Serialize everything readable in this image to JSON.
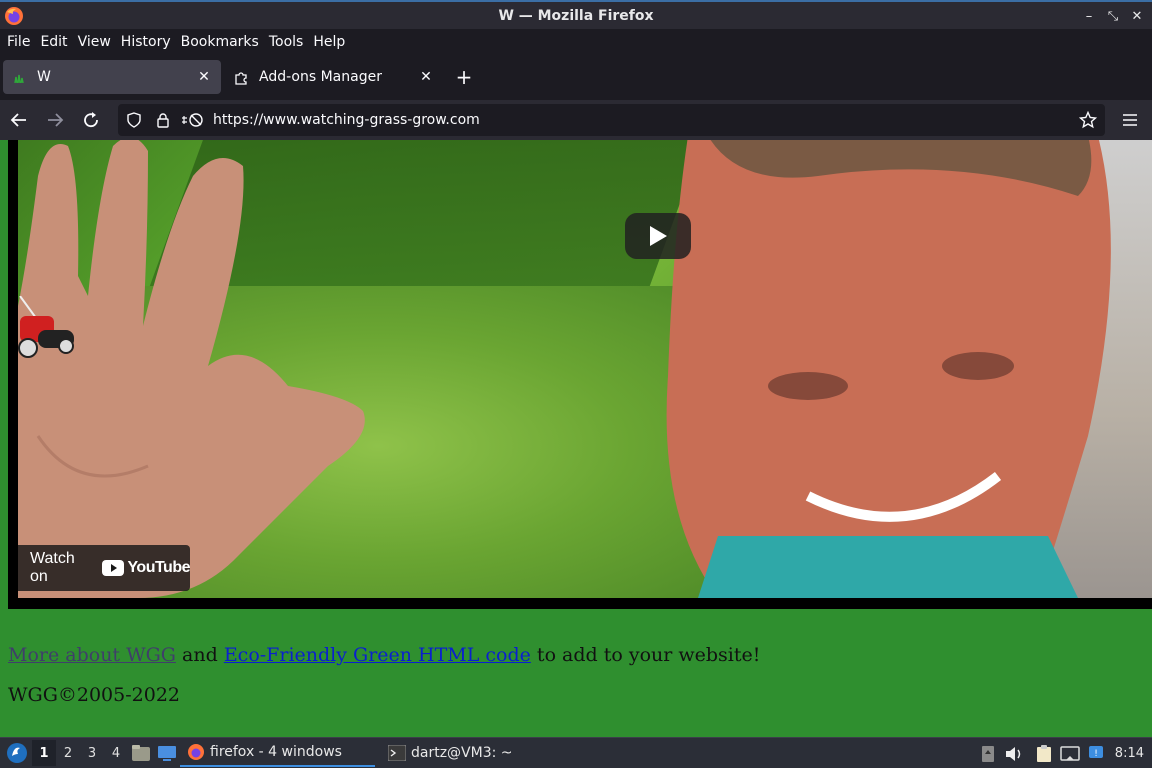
{
  "window": {
    "title": "W — Mozilla Firefox"
  },
  "menubar": {
    "items": [
      "File",
      "Edit",
      "View",
      "History",
      "Bookmarks",
      "Tools",
      "Help"
    ]
  },
  "tabs": [
    {
      "label": "W",
      "active": true,
      "icon": "grass-favicon"
    },
    {
      "label": "Add-ons Manager",
      "active": false,
      "icon": "puzzle-icon"
    }
  ],
  "navbar": {
    "url": "https://www.watching-grass-grow.com"
  },
  "video": {
    "watch_on_label": "Watch on",
    "youtube_wordmark": "YouTube"
  },
  "content": {
    "link_more": "More about WGG",
    "text_and": " and ",
    "link_eco": "Eco-Friendly Green HTML code",
    "text_tail": " to add to your website!",
    "copyright": "WGG©2005-2022"
  },
  "taskbar": {
    "workspaces": [
      "1",
      "2",
      "3",
      "4"
    ],
    "active_workspace": "1",
    "tasks": [
      {
        "label": "firefox - 4 windows",
        "icon": "firefox-icon",
        "active": true
      },
      {
        "label": "dartz@VM3: ~",
        "icon": "terminal-icon",
        "active": false
      }
    ],
    "clock": "8:14"
  },
  "colors": {
    "page_background": "#2f8f2f",
    "link": "#0a1fd0",
    "visited_link": "#3f3f6a",
    "taskbar_accent": "#3d8ee0"
  }
}
